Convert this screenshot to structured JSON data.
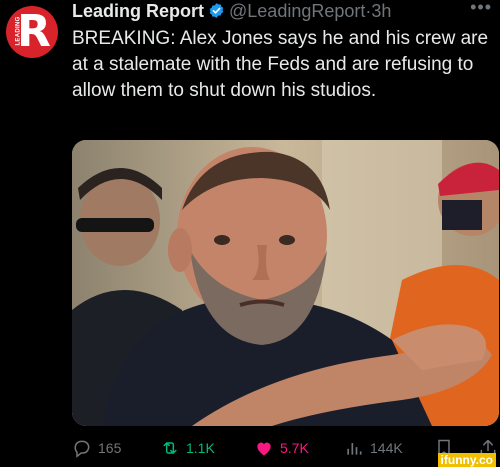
{
  "account": {
    "name": "Leading Report",
    "handle": "@LeadingReport",
    "separator": "·",
    "time": "3h",
    "avatar_letter": "R",
    "avatar_text": "LEADING"
  },
  "tweet": {
    "text": "BREAKING: Alex Jones says he and his crew are at a stalemate with the Feds and are refusing to allow them to shut down his studios."
  },
  "actions": {
    "replies": "165",
    "retweets": "1.1K",
    "likes": "5.7K",
    "views": "144K"
  },
  "icons": {
    "verified": "verified-badge-icon",
    "more": "more-icon",
    "reply": "reply-icon",
    "retweet": "retweet-icon",
    "like": "heart-icon",
    "views": "views-icon",
    "bookmark": "bookmark-icon",
    "share": "share-icon"
  },
  "colors": {
    "background": "#000000",
    "text": "#e7e9ea",
    "muted": "#71767b",
    "verified": "#1d9bf0",
    "retweet": "#00ba7c",
    "like": "#f91880",
    "avatar": "#d8232a"
  },
  "watermark": "ifunny.co"
}
